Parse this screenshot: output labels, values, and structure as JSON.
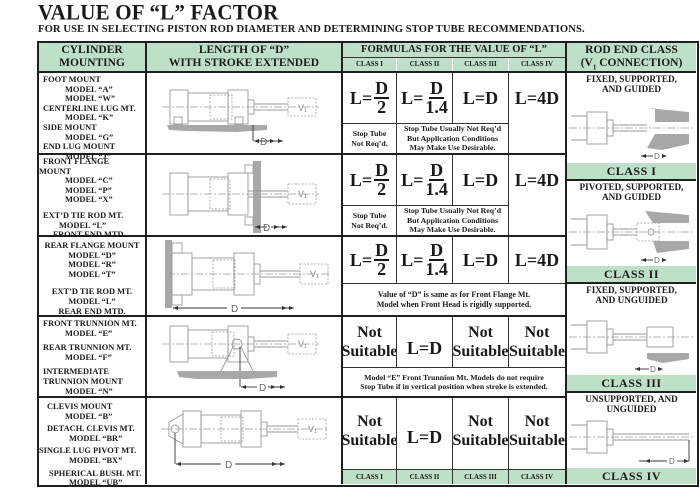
{
  "title": "VALUE OF “L” FACTOR",
  "subtitle": "FOR USE IN SELECTING PISTON ROD DIAMETER AND DETERMINING STOP TUBE RECOMMENDATIONS.",
  "colors": {
    "header_green": "#bfe0c8",
    "border": "#1f1f1f",
    "drawing_gray": "#9a9a9a"
  },
  "headers": {
    "mounting": [
      "CYLINDER",
      "MOUNTING"
    ],
    "length": [
      "LENGTH OF “D”",
      "WITH STROKE EXTENDED"
    ],
    "formulas": "FORMULAS FOR THE VALUE OF “L”",
    "classes": [
      "CLASS I",
      "CLASS II",
      "CLASS III",
      "CLASS IV"
    ],
    "rod_end": [
      "ROD END CLASS",
      "(V",
      "1",
      " CONNECTION)"
    ]
  },
  "rows": [
    {
      "mounting": [
        "FOOT MOUNT",
        "MODEL “A”",
        "MODEL “W”",
        "CENTERLINE LUG MT.",
        "MODEL “K”",
        "SIDE MOUNT",
        "MODEL “G”",
        "END LUG MOUNT",
        "MODEL “J”"
      ],
      "formulas": {
        "c1_num": "D",
        "c1_den": "2",
        "c2_num": "D",
        "c2_den": "1.4",
        "c3": "L=D",
        "c4": "L=4D",
        "prefix": "L="
      },
      "notes": {
        "c1": [
          "Stop Tube",
          "Not Req’d."
        ],
        "c23": [
          "Stop Tube Usually Not Req’d",
          "But Application Conditions",
          "May Make Use Desirable."
        ]
      },
      "drawing": {
        "v_label": "V1",
        "d_label": "D"
      }
    },
    {
      "mounting": [
        "FRONT FLANGE",
        "MOUNT",
        "MODEL “C”",
        "MODEL “P”",
        "MODEL “X”",
        "EXT’D TIE ROD MT.",
        "MODEL “L”",
        "FRONT END MTD."
      ],
      "formulas": {
        "c1_num": "D",
        "c1_den": "2",
        "c2_num": "D",
        "c2_den": "1.4",
        "c3": "L=D",
        "c4": "L=4D",
        "prefix": "L="
      },
      "notes": {
        "c1": [
          "Stop Tube",
          "Not Req’d."
        ],
        "c23": [
          "Stop Tube Usually Not Req’d",
          "But Application Conditions",
          "May Make Use Desirable."
        ]
      },
      "drawing": {
        "v_label": "V1",
        "d_label": "D"
      }
    },
    {
      "mounting": [
        "REAR FLANGE MOUNT",
        "MODEL “D”",
        "MODEL “R”",
        "MODEL “T”",
        "EXT’D TIE ROD MT.",
        "MODEL “L”",
        "REAR END MTD."
      ],
      "formulas": {
        "c1_num": "D",
        "c1_den": "2",
        "c2_num": "D",
        "c2_den": "1.4",
        "c3": "L=D",
        "c4": "L=4D",
        "prefix": "L="
      },
      "notes": {
        "full": [
          "Value of “D” is same as for Front Flange Mt.",
          "Model when Front Head is rigidly supported."
        ]
      },
      "drawing": {
        "v_label": "V1",
        "d_label": "D"
      }
    },
    {
      "mounting": [
        "FRONT TRUNNION MT.",
        "MODEL “E”",
        "REAR TRUNNION MT.",
        "MODEL “F”",
        "INTERMEDIATE",
        "TRUNNION MOUNT",
        "MODEL “N”"
      ],
      "formulas": {
        "c1": [
          "Not",
          "Suitable"
        ],
        "c2": "L=D",
        "c3": [
          "Not",
          "Suitable"
        ],
        "c4": [
          "Not",
          "Suitable"
        ]
      },
      "notes": {
        "full": [
          "Model “E” Front Trunnion Mt. Models do not require",
          "Stop Tube if in vertical position when stroke is extended."
        ]
      },
      "drawing": {
        "v_label": "V1",
        "d_label": "D"
      }
    },
    {
      "mounting": [
        "CLEVIS MOUNT",
        "MODEL “B”",
        "DETACH. CLEVIS MT.",
        "MODEL “BR”",
        "SINGLE LUG PIVOT MT.",
        "MODEL “BX”",
        "SPHERICAL BUSH. MT.",
        "MODEL “UB”"
      ],
      "formulas": {
        "c1": [
          "Not",
          "Suitable"
        ],
        "c2": "L=D",
        "c3": [
          "Not",
          "Suitable"
        ],
        "c4": [
          "Not",
          "Suitable"
        ]
      },
      "drawing": {
        "v_label": "V1",
        "d_label": "D"
      }
    }
  ],
  "rod_classes": [
    {
      "desc": [
        "FIXED, SUPPORTED,",
        "AND GUIDED"
      ],
      "label": "CLASS  I"
    },
    {
      "desc": [
        "PIVOTED, SUPPORTED,",
        "AND GUIDED"
      ],
      "label": "CLASS  II"
    },
    {
      "desc": [
        "FIXED, SUPPORTED,",
        "AND UNGUIDED"
      ],
      "label": "CLASS  III"
    },
    {
      "desc": [
        "UNSUPPORTED, AND",
        "UNGUIDED"
      ],
      "label": "CLASS  IV"
    }
  ]
}
